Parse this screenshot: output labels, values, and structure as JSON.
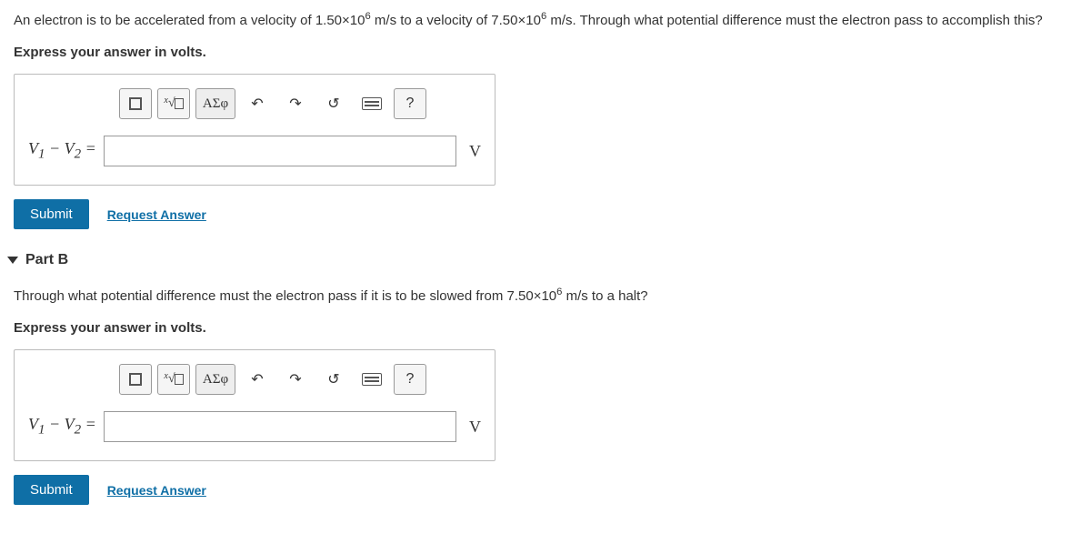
{
  "partA": {
    "problem_html": "An electron is to be accelerated from a velocity of 1.50×10<sup>6</sup> m/s to a velocity of 7.50×10<sup>6</sup> m/s. Through what potential difference must the electron pass to accomplish this?",
    "instruction": "Express your answer in volts.",
    "var_label_html": "<i>V</i><sub>1</sub> − <i>V</i><sub>2</sub> =",
    "unit": "V",
    "submit": "Submit",
    "request": "Request Answer",
    "greek": "ΑΣφ",
    "help": "?"
  },
  "partB": {
    "header": "Part B",
    "problem_html": "Through what potential difference must the electron pass if it is to be slowed from 7.50×10<sup>6</sup> m/s to a halt?",
    "instruction": "Express your answer in volts.",
    "var_label_html": "<i>V</i><sub>1</sub> − <i>V</i><sub>2</sub> =",
    "unit": "V",
    "submit": "Submit",
    "request": "Request Answer",
    "greek": "ΑΣφ",
    "help": "?"
  }
}
